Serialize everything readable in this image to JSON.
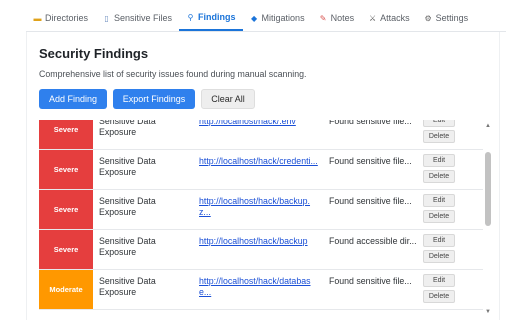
{
  "tabs": [
    {
      "icon": "folder-icon",
      "glyph": "▬",
      "label": "Directories",
      "active": false
    },
    {
      "icon": "file-icon",
      "glyph": "▯",
      "label": "Sensitive Files",
      "active": false
    },
    {
      "icon": "search-icon",
      "glyph": "⚲",
      "label": "Findings",
      "active": true
    },
    {
      "icon": "shield-icon",
      "glyph": "◆",
      "label": "Mitigations",
      "active": false
    },
    {
      "icon": "notes-icon",
      "glyph": "✎",
      "label": "Notes",
      "active": false
    },
    {
      "icon": "swords-icon",
      "glyph": "⚔",
      "label": "Attacks",
      "active": false
    },
    {
      "icon": "gear-icon",
      "glyph": "⚙",
      "label": "Settings",
      "active": false
    }
  ],
  "page": {
    "title": "Security Findings",
    "subtitle": "Comprehensive list of security issues found during manual scanning."
  },
  "toolbar": {
    "add_label": "Add Finding",
    "export_label": "Export Findings",
    "clear_label": "Clear All"
  },
  "findings": [
    {
      "severity": "Severe",
      "type": "Sensitive Data Exposure",
      "url": "http://localhost/hack/.env",
      "description": "Found sensitive file..."
    },
    {
      "severity": "Severe",
      "type": "Sensitive Data Exposure",
      "url": "http://localhost/hack/credenti...",
      "description": "Found sensitive file..."
    },
    {
      "severity": "Severe",
      "type": "Sensitive Data Exposure",
      "url": "http://localhost/hack/backup.z...",
      "description": "Found sensitive file..."
    },
    {
      "severity": "Severe",
      "type": "Sensitive Data Exposure",
      "url": "http://localhost/hack/backup",
      "description": "Found accessible dir..."
    },
    {
      "severity": "Moderate",
      "type": "Sensitive Data Exposure",
      "url": "http://localhost/hack/databas e...",
      "description": "Found sensitive file..."
    }
  ],
  "row_actions": {
    "edit_label": "Edit",
    "delete_label": "Delete"
  },
  "colors": {
    "accent": "#2f80ed",
    "severe": "#e53e3e",
    "moderate": "#ff9800",
    "link": "#1a4fd6"
  }
}
